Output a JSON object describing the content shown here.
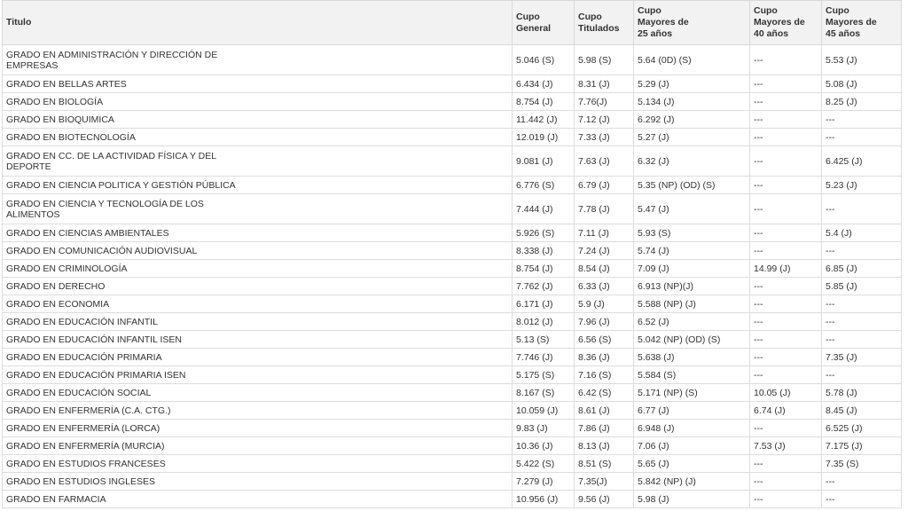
{
  "headers": [
    {
      "lines": [
        "Titulo"
      ]
    },
    {
      "lines": [
        "Cupo",
        "General"
      ]
    },
    {
      "lines": [
        "Cupo",
        "Titulados"
      ]
    },
    {
      "lines": [
        "Cupo",
        "Mayores de",
        "25 años"
      ]
    },
    {
      "lines": [
        "Cupo",
        "Mayores de",
        "40 años"
      ]
    },
    {
      "lines": [
        "Cupo",
        "Mayores de",
        "45 años"
      ]
    }
  ],
  "rows": [
    [
      "GRADO EN ADMINISTRACIÓN Y DIRECCIÓN DE\nEMPRESAS",
      "5.046  (S)",
      "5.98 (S)",
      "5.64  (0D) (S)",
      "---",
      "5.53 (J)"
    ],
    [
      "GRADO EN BELLAS ARTES",
      "6.434  (J)",
      "8.31 (J)",
      "5.29  (J)",
      "---",
      "5.08 (J)"
    ],
    [
      "GRADO EN BIOLOGÍA",
      "8.754  (J)",
      "7.76(J)",
      "5.134 (J)",
      "---",
      "8.25 (J)"
    ],
    [
      "GRADO EN BIOQUIMICA",
      "11.442 (J)",
      "7.12 (J)",
      "6.292 (J)",
      "---",
      "---"
    ],
    [
      "GRADO EN BIOTECNOLOGÍA",
      "12.019 (J)",
      "7.33 (J)",
      "5.27 (J)",
      "---",
      "---"
    ],
    [
      "GRADO EN CC. DE LA ACTIVIDAD FÍSICA Y DEL\nDEPORTE",
      "9.081  (J)",
      "7.63 (J)",
      "6.32  (J)",
      "---",
      "6.425 (J)"
    ],
    [
      "GRADO EN CIENCIA POLITICA Y GESTIÓN PÚBLICA",
      "6.776  (S)",
      "6.79 (J)",
      "5.35 (NP) (OD) (S)",
      "---",
      "5.23 (J)"
    ],
    [
      "GRADO EN CIENCIA Y TECNOLOGÍA DE LOS\nALIMENTOS",
      "7.444  (J)",
      "7.78 (J)",
      "5.47 (J)",
      "---",
      "---"
    ],
    [
      "GRADO EN CIENCIAS AMBIENTALES",
      "5.926 (S)",
      "7.11 (J)",
      "5.93  (S)",
      "---",
      "5.4 (J)"
    ],
    [
      "GRADO EN COMUNICACIÓN AUDIOVISUAL",
      "8.338  (J)",
      "7.24 (J)",
      "5.74  (J)",
      "---",
      "---"
    ],
    [
      "GRADO EN CRIMINOLOGÍA",
      "8.754  (J)",
      "8.54 (J)",
      "7.09 (J)",
      "14.99  (J)",
      "6.85  (J)"
    ],
    [
      "GRADO EN DERECHO",
      "7.762  (J)",
      "6.33 (J)",
      "6.913  (NP)(J)",
      "---",
      "5.85 (J)"
    ],
    [
      "GRADO EN ECONOMIA",
      "6.171  (J)",
      "5.9  (J)",
      "5.588 (NP) (J)",
      "---",
      "---"
    ],
    [
      "GRADO EN EDUCACIÓN INFANTIL",
      "8.012  (J)",
      "7.96 (J)",
      "6.52  (J)",
      "---",
      "---"
    ],
    [
      "GRADO EN EDUCACIÓN INFANTIL ISEN",
      "5.13  (S)",
      "6.56 (S)",
      "5.042  (NP) (OD) (S)",
      "---",
      "---"
    ],
    [
      "GRADO EN EDUCACIÓN PRIMARIA",
      "7.746  (J)",
      "8.36 (J)",
      "5.638  (J)",
      "---",
      "7.35 (J)"
    ],
    [
      "GRADO EN EDUCACIÓN PRIMARIA ISEN",
      "5.175  (S)",
      "7.16 (S)",
      "5.584  (S)",
      "---",
      "---"
    ],
    [
      "GRADO EN EDUCACIÓN SOCIAL",
      "8.167  (S)",
      "6.42 (S)",
      "5.171  (NP) (S)",
      "10.05  (J)",
      "5.78 (J)"
    ],
    [
      "GRADO EN ENFERMERÍA (C.A. CTG.)",
      "10.059 (J)",
      "8.61 (J)",
      "6.77 (J)",
      "6.74 (J)",
      "8.45 (J)"
    ],
    [
      "GRADO EN ENFERMERÍA (LORCA)",
      "9.83  (J)",
      "7.86 (J)",
      "6.948  (J)",
      "---",
      "6.525  (J)"
    ],
    [
      "GRADO EN ENFERMERÍA (MURCIA)",
      "10.36 (J)",
      "8.13 (J)",
      "7.06 (J)",
      "7.53 (J)",
      "7.175 (J)"
    ],
    [
      "GRADO EN ESTUDIOS  FRANCESES",
      "5.422  (S)",
      "8.51 (S)",
      "5.65 (J)",
      "---",
      "7.35 (S)"
    ],
    [
      "GRADO EN ESTUDIOS  INGLESES",
      "7.279  (J)",
      "7.35(J)",
      "5.842 (NP) (J)",
      "---",
      "---"
    ],
    [
      "GRADO EN FARMACIA",
      "10.956  (J)",
      "9.56 (J)",
      "5.98  (J)",
      "---",
      "---"
    ]
  ]
}
